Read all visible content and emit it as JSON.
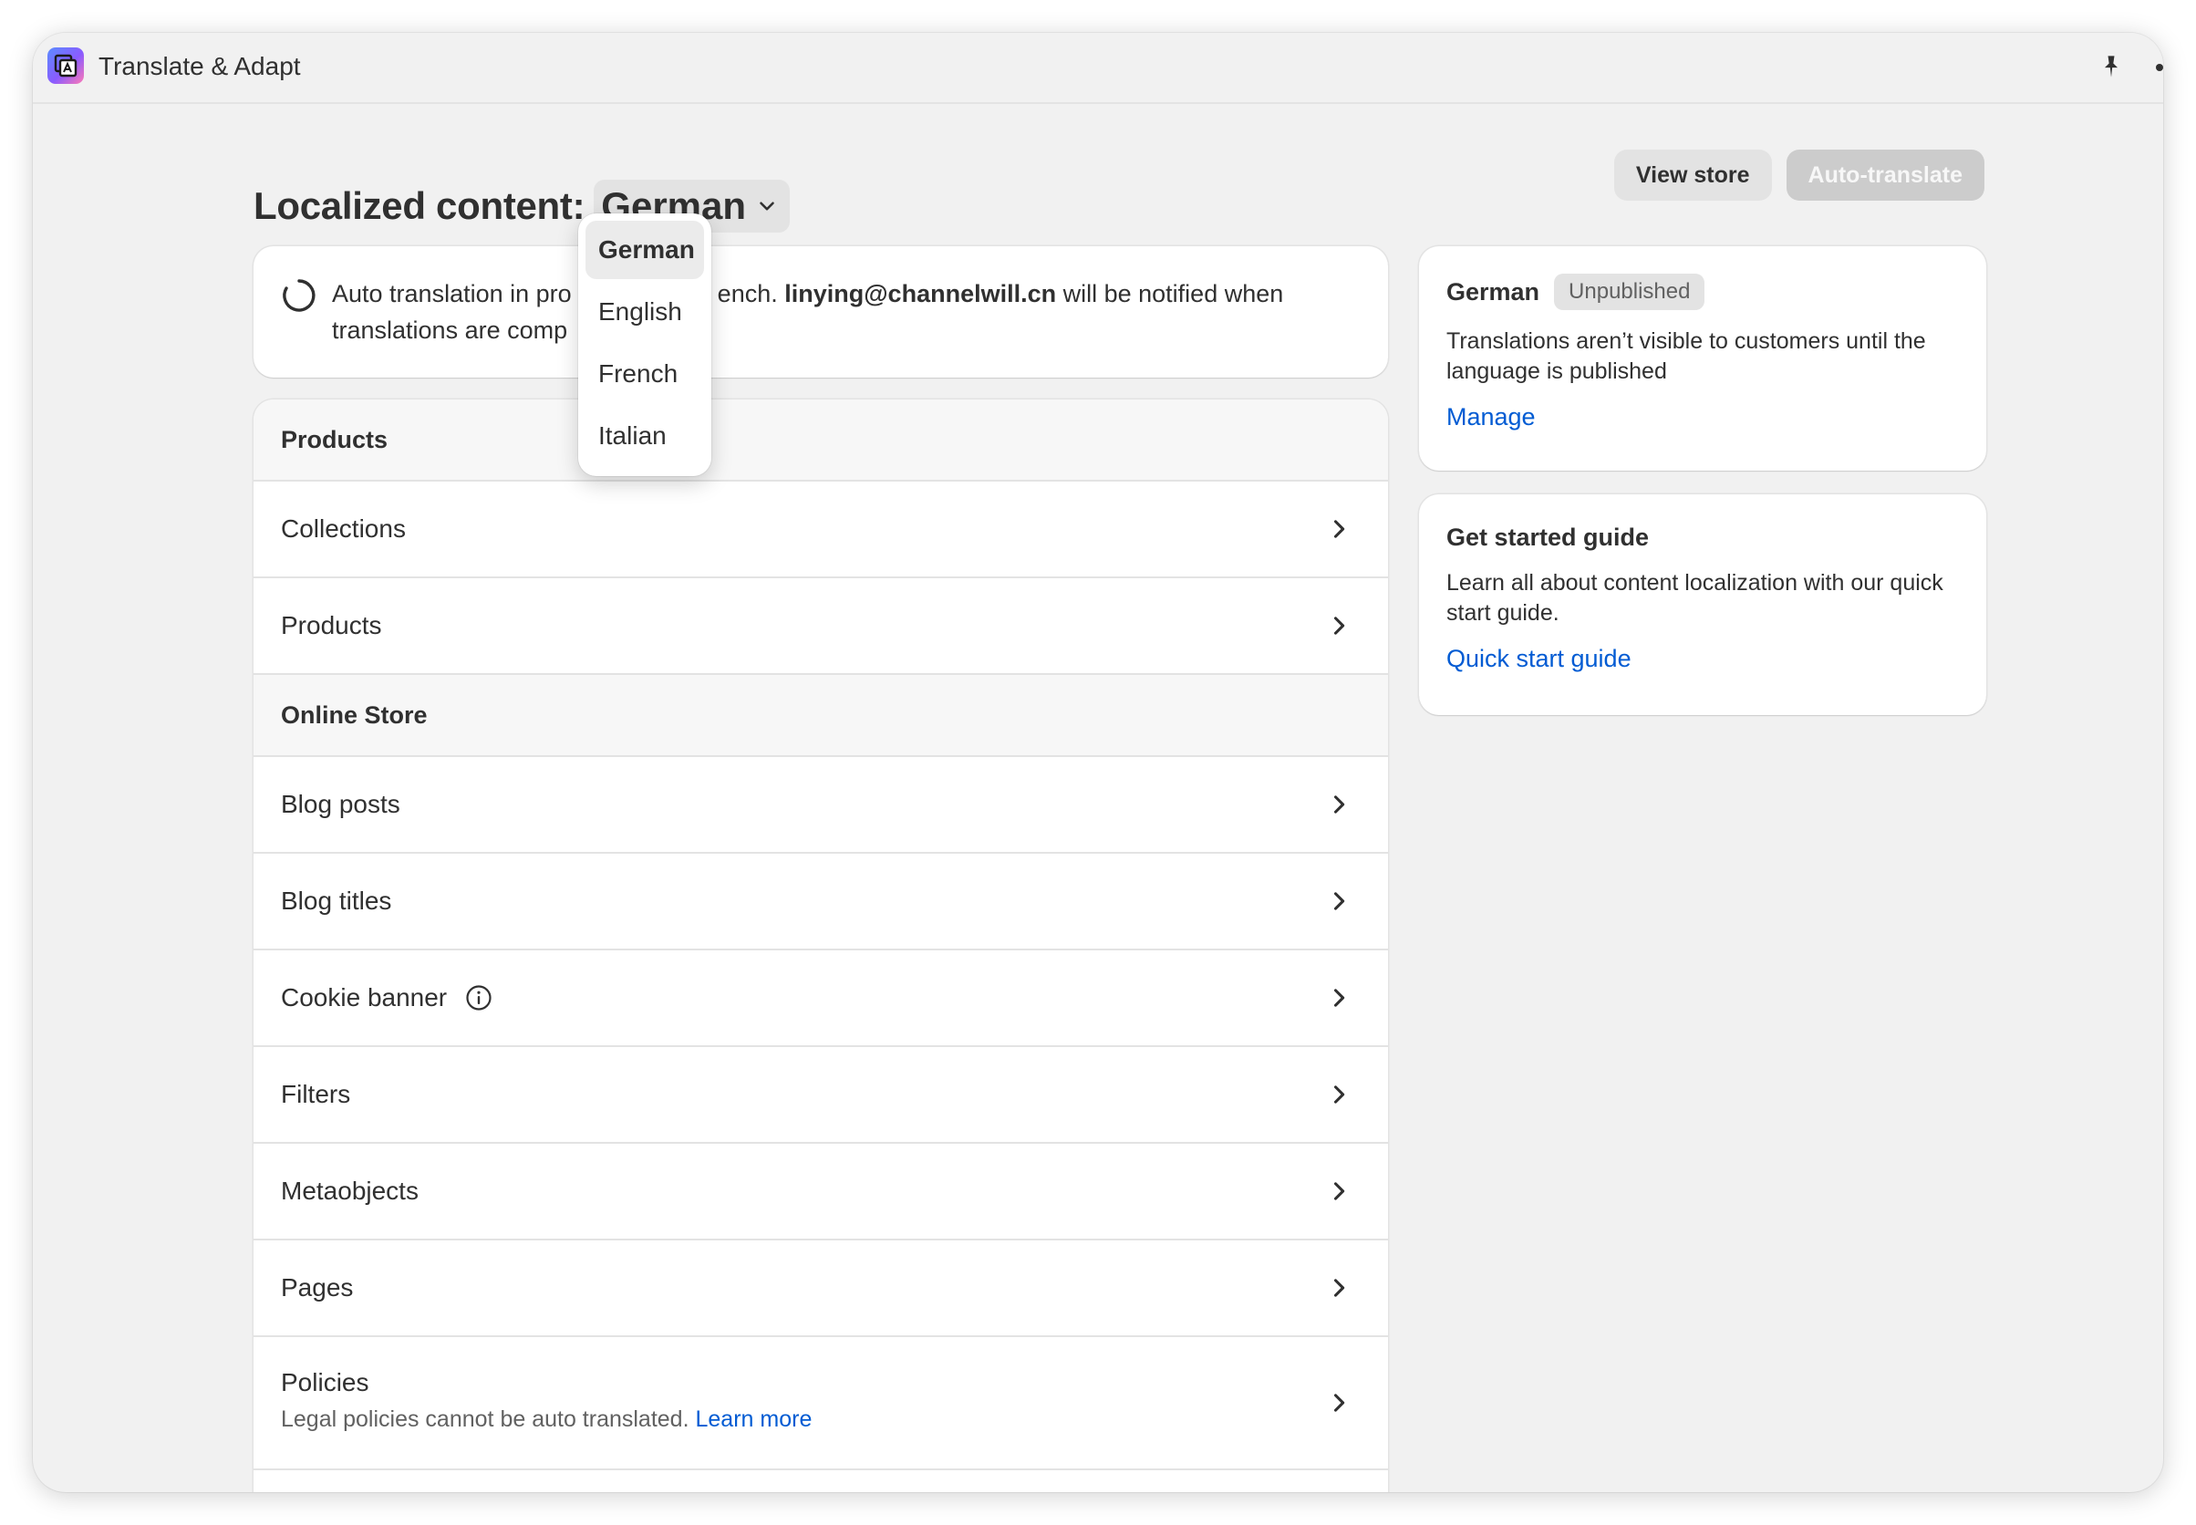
{
  "app": {
    "title": "Translate & Adapt"
  },
  "header": {
    "title_prefix": "Localized content:",
    "selected_language": "German",
    "view_store_label": "View store",
    "auto_translate_label": "Auto-translate"
  },
  "language_menu": {
    "options": [
      "German",
      "English",
      "French",
      "Italian"
    ],
    "selected": "German"
  },
  "banner": {
    "text_before": "Auto translation in pro",
    "text_mid": "ench. ",
    "email": "linying@channelwill.cn",
    "text_after": " will be notified when",
    "line2": "translations are comp"
  },
  "resources": {
    "section_products": "Products",
    "products_items": [
      "Collections",
      "Products"
    ],
    "section_online_store": "Online Store",
    "online_store_items": [
      "Blog posts",
      "Blog titles",
      "Cookie banner",
      "Filters",
      "Metaobjects",
      "Pages"
    ],
    "policies": {
      "label": "Policies",
      "sub_text": "Legal policies cannot be auto translated.",
      "link": "Learn more"
    }
  },
  "language_card": {
    "language": "German",
    "status": "Unpublished",
    "description": "Translations aren’t visible to customers until the language is published",
    "link": "Manage"
  },
  "guide_card": {
    "title": "Get started guide",
    "description": "Learn all about content localization with our quick start guide.",
    "link": "Quick start guide"
  },
  "colors": {
    "background": "#f1f1f1",
    "card": "#ffffff",
    "link": "#005bd3",
    "text": "#303030",
    "disabled_button": "#cccccc"
  }
}
